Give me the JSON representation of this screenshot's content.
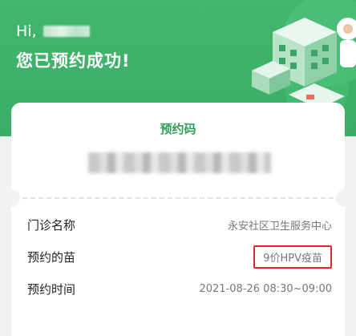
{
  "header": {
    "greeting": "Hi,",
    "success_text": "您已预约成功!"
  },
  "card": {
    "title": "预约码",
    "rows": [
      {
        "label": "门诊名称",
        "value": "永安社区卫生服务中心"
      },
      {
        "label": "预约的苗",
        "value": "9价HPV疫苗"
      },
      {
        "label": "预约时间",
        "value": "2021-08-26 08:30~09:00"
      }
    ]
  },
  "colors": {
    "brand_green": "#3aae66",
    "highlight_red": "#e0252b"
  },
  "icons": [
    "clinic-illustration"
  ]
}
